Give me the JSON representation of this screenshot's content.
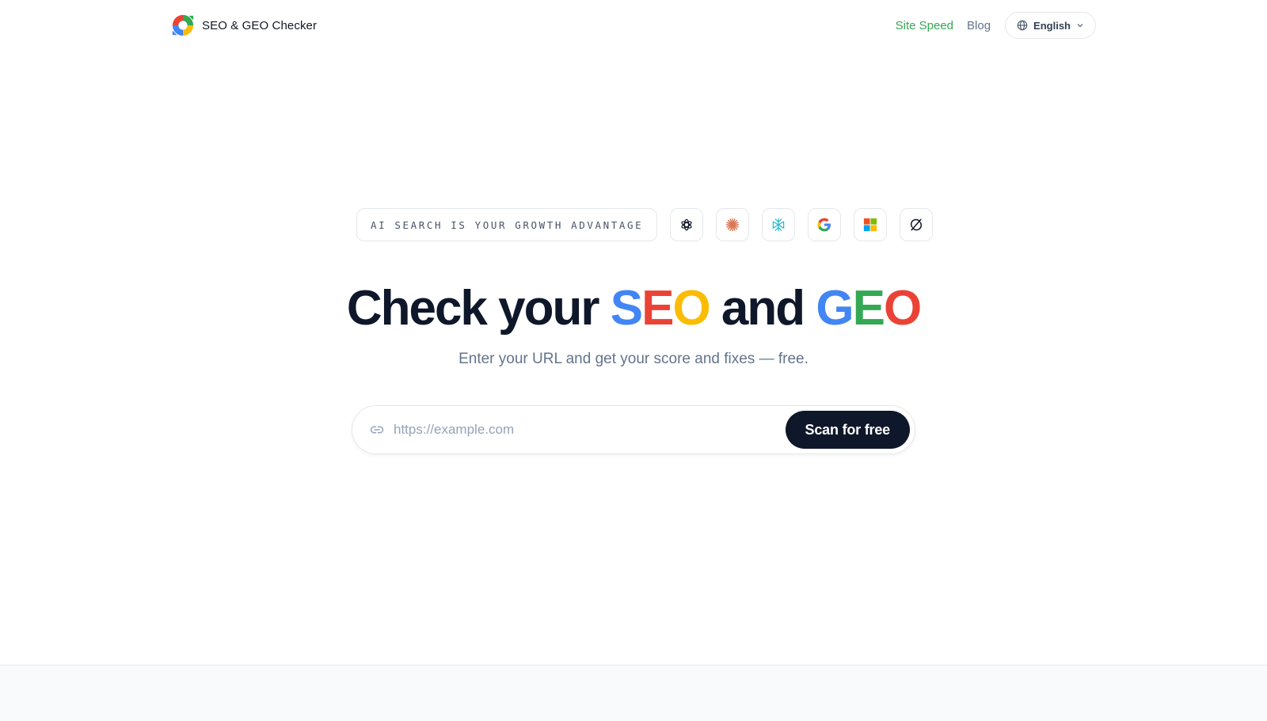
{
  "header": {
    "brand_name": "SEO & GEO Checker",
    "nav": {
      "site_speed": "Site Speed",
      "blog": "Blog",
      "language": "English"
    }
  },
  "hero": {
    "badge_text": "AI SEARCH IS YOUR GROWTH ADVANTAGE",
    "ai_logos": [
      "openai-icon",
      "claude-icon",
      "perplexity-icon",
      "google-icon",
      "microsoft-icon",
      "grok-icon"
    ],
    "headline": {
      "prefix": "Check your ",
      "seo": [
        "S",
        "E",
        "O"
      ],
      "middle": " and ",
      "geo": [
        "G",
        "E",
        "O"
      ]
    },
    "subtitle": "Enter your URL and get your score and fixes — free.",
    "search": {
      "placeholder": "https://example.com",
      "value": "",
      "button_label": "Scan for free"
    }
  },
  "colors": {
    "google_blue": "#4285f4",
    "google_red": "#ea4335",
    "google_yellow": "#fbbc05",
    "google_green": "#34a853",
    "primary_dark": "#0f172a"
  }
}
